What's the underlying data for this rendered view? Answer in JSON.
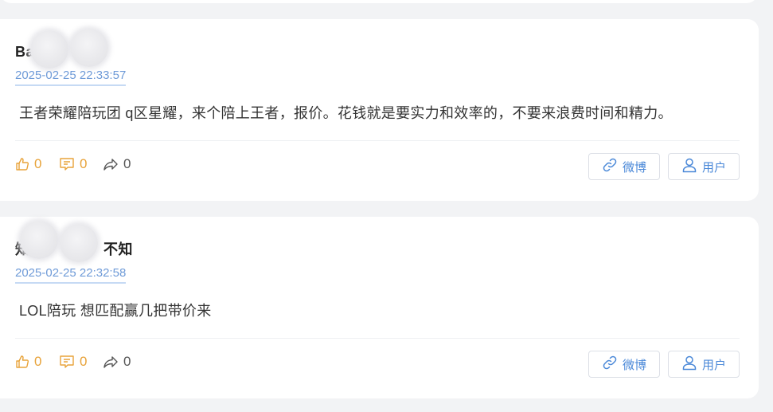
{
  "posts": [
    {
      "author": "Ba　　　　　",
      "timestamp": "2025-02-25 22:33:57",
      "content": "王者荣耀陪玩团 q区星耀，来个陪上王者，报价。花钱就是要实力和效率的，不要来浪费时间和精力。",
      "likes": "0",
      "comments": "0",
      "shares": "0",
      "weibo_label": "微博",
      "user_label": "用户"
    },
    {
      "author": "知　　　　　不知",
      "timestamp": "2025-02-25 22:32:58",
      "content": "LOL陪玩 想匹配赢几把带价来",
      "likes": "0",
      "comments": "0",
      "shares": "0",
      "weibo_label": "微博",
      "user_label": "用户"
    }
  ],
  "icons": {
    "like": "thumbs-up-icon",
    "comment": "comment-icon",
    "share": "share-icon",
    "weibo": "link-icon",
    "user": "user-icon"
  },
  "colors": {
    "accent": "#4a88d8",
    "timestamp": "#6f9bd8",
    "stat_orange": "#e8a33a",
    "background": "#f2f3f5"
  }
}
